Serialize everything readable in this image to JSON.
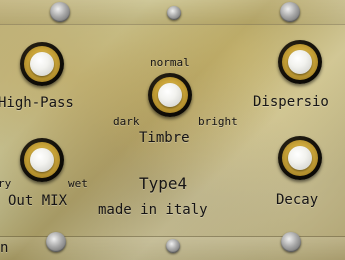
{
  "plugin": {
    "knob_labels": {
      "high_pass": "High-Pass",
      "dispersion": "Dispersio",
      "timbre": "Timbre",
      "out_mix": "Out MIX",
      "decay": "Decay"
    },
    "timbre_scale": {
      "dark": "dark",
      "normal": "normal",
      "bright": "bright"
    },
    "mix_scale": {
      "dry": "ry",
      "wet": "wet"
    },
    "branding": {
      "model": "Type4",
      "made_in": "made in italy",
      "corner_fragment": "n"
    }
  }
}
